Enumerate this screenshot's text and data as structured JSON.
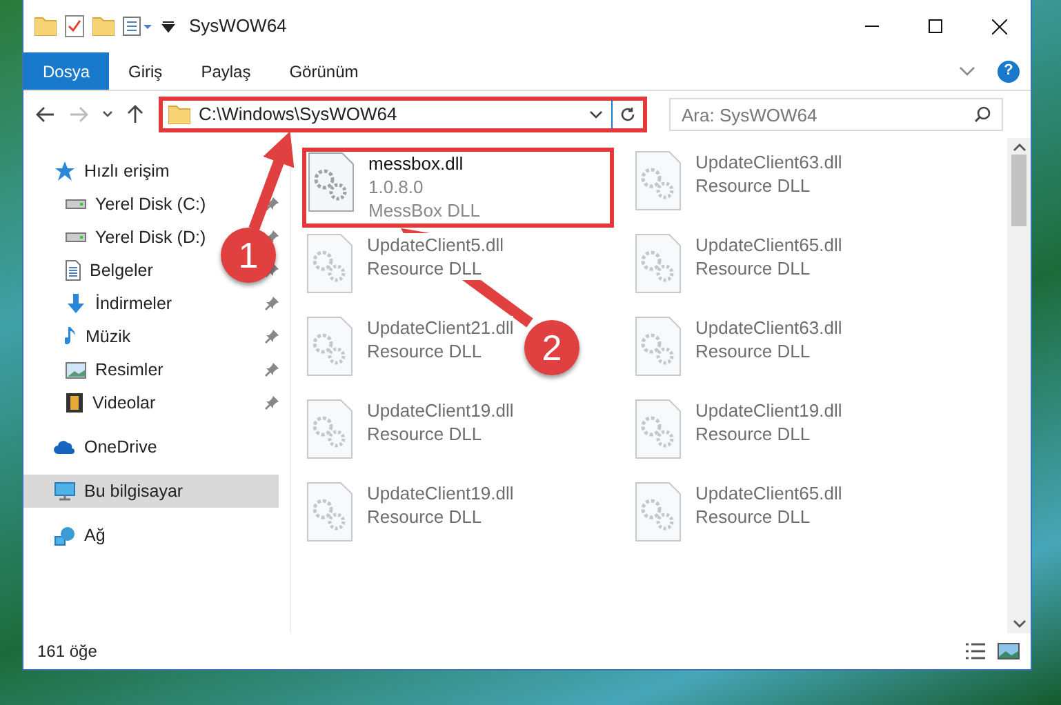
{
  "window": {
    "title": "SysWOW64"
  },
  "ribbon": {
    "tabs": [
      {
        "label": "Dosya",
        "selected": true
      },
      {
        "label": "Giriş",
        "selected": false
      },
      {
        "label": "Paylaş",
        "selected": false
      },
      {
        "label": "Görünüm",
        "selected": false
      }
    ],
    "help": "?"
  },
  "address": {
    "path": "C:\\Windows\\SysWOW64",
    "outlined": true
  },
  "search": {
    "placeholder": "Ara: SysWOW64"
  },
  "sidebar": {
    "items": [
      {
        "label": "Hızlı erişim",
        "kind": "star",
        "selected": false,
        "children": [
          {
            "label": "Yerel Disk (C:)",
            "kind": "drive",
            "pinned": true,
            "selected": false
          },
          {
            "label": "Yerel Disk (D:)",
            "kind": "drive",
            "pinned": true,
            "selected": false
          },
          {
            "label": "Belgeler",
            "kind": "document",
            "pinned": true,
            "selected": false
          },
          {
            "label": "İndirmeler",
            "kind": "download",
            "pinned": true,
            "selected": false
          },
          {
            "label": "Müzik",
            "kind": "music",
            "pinned": true,
            "selected": false
          },
          {
            "label": "Resimler",
            "kind": "picture",
            "pinned": true,
            "selected": false
          },
          {
            "label": "Videolar",
            "kind": "video",
            "pinned": true,
            "selected": false
          }
        ]
      },
      {
        "label": "OneDrive",
        "kind": "cloud",
        "selected": false
      },
      {
        "label": "Bu bilgisayar",
        "kind": "computer",
        "selected": true
      },
      {
        "label": "Ağ",
        "kind": "network",
        "selected": false
      }
    ]
  },
  "files": [
    {
      "name": "messbox.dll",
      "details": [
        "1.0.8.0",
        "MessBox DLL"
      ],
      "blurred": false,
      "outlined": true
    },
    {
      "name": "UpdateClient63.dll",
      "details": [
        "Resource DLL"
      ],
      "blurred": true,
      "outlined": false
    },
    {
      "name": "UpdateClient5.dll",
      "details": [
        "Resource DLL"
      ],
      "blurred": true,
      "outlined": false
    },
    {
      "name": "UpdateClient65.dll",
      "details": [
        "Resource DLL"
      ],
      "blurred": true,
      "outlined": false
    },
    {
      "name": "UpdateClient21.dll",
      "details": [
        "Resource DLL"
      ],
      "blurred": true,
      "outlined": false
    },
    {
      "name": "UpdateClient63.dll",
      "details": [
        "Resource DLL"
      ],
      "blurred": true,
      "outlined": false
    },
    {
      "name": "UpdateClient19.dll",
      "details": [
        "Resource DLL"
      ],
      "blurred": true,
      "outlined": false
    },
    {
      "name": "UpdateClient19.dll",
      "details": [
        "Resource DLL"
      ],
      "blurred": true,
      "outlined": false
    },
    {
      "name": "UpdateClient19.dll",
      "details": [
        "Resource DLL"
      ],
      "blurred": true,
      "outlined": false
    },
    {
      "name": "UpdateClient65.dll",
      "details": [
        "Resource DLL"
      ],
      "blurred": true,
      "outlined": false
    }
  ],
  "status_bar": {
    "count": "161 öğe"
  },
  "annotations": [
    {
      "number": "1"
    },
    {
      "number": "2"
    }
  ]
}
